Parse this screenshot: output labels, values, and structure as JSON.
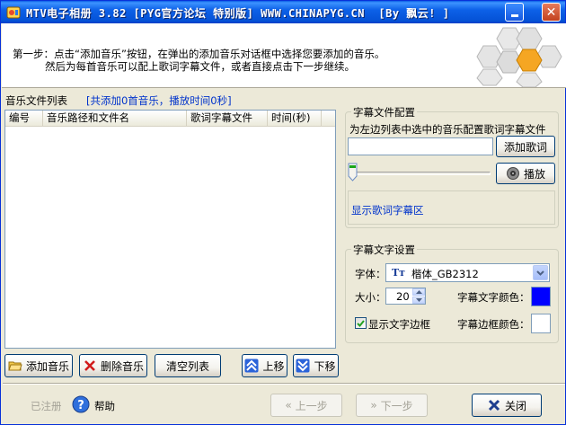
{
  "window": {
    "title": "MTV电子相册 3.82 [PYG官方论坛 特别版] WWW.CHINAPYG.CN  [By 飘云! ]"
  },
  "header": {
    "step_line1": "第一步：点击“添加音乐”按钮，在弹出的添加音乐对话框中选择您要添加的音乐。",
    "step_line2": "然后为每首音乐可以配上歌词字幕文件，或者直接点击下一步继续。"
  },
  "music_list": {
    "label": "音乐文件列表",
    "info": "[共添加0首音乐，播放时间0秒]",
    "columns": [
      "编号",
      "音乐路径和文件名",
      "歌词字幕文件",
      "时间(秒)"
    ],
    "rows": []
  },
  "lyrics_config": {
    "title": "字幕文件配置",
    "hint": "为左边列表中选中的音乐配置歌词字幕文件",
    "file_value": "",
    "add_lyrics_label": "添加歌词",
    "play_label": "播放",
    "show_lyrics_label": "显示歌词字幕区"
  },
  "text_settings": {
    "title": "字幕文字设置",
    "font_label": "字体：",
    "font_value": "楷体_GB2312",
    "size_label": "大小：",
    "size_value": "20",
    "text_color_label": "字幕文字颜色：",
    "text_color": "#0000ff",
    "show_border_label": "显示文字边框",
    "show_border_checked": true,
    "border_color_label": "字幕边框颜色：",
    "border_color": "#ffffff"
  },
  "list_buttons": {
    "add_music": "添加音乐",
    "delete_music": "删除音乐",
    "clear_list": "清空列表",
    "move_up": "上移",
    "move_down": "下移"
  },
  "footer": {
    "registered": "已注册",
    "help": "帮助",
    "prev": "上一步",
    "next": "下一步",
    "close": "关闭"
  },
  "colors": {
    "titlebar": "#0552d6",
    "link_blue": "#0033cc",
    "dialog_bg": "#ece9d8"
  }
}
